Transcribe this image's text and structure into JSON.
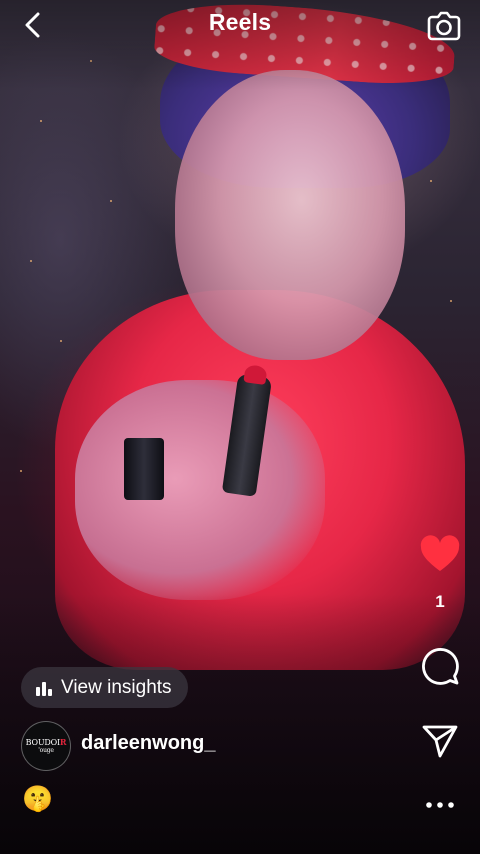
{
  "header": {
    "title": "Reels",
    "back_icon": "chevron-left-icon",
    "camera_icon": "camera-icon"
  },
  "actions": {
    "like_icon": "heart-filled-icon",
    "like_color": "#ff3040",
    "like_count": "1",
    "comment_icon": "comment-bubble-icon",
    "share_icon": "paper-plane-icon",
    "more_icon": "more-horizontal-icon"
  },
  "reel": {
    "insights_icon": "bar-chart-icon",
    "insights_label": "View insights",
    "avatar_brand_left": "BOUDOI",
    "avatar_brand_accent": "R",
    "avatar_brand_tail": "'ouge",
    "username": "darleenwong_",
    "caption_emoji": "🤫"
  }
}
